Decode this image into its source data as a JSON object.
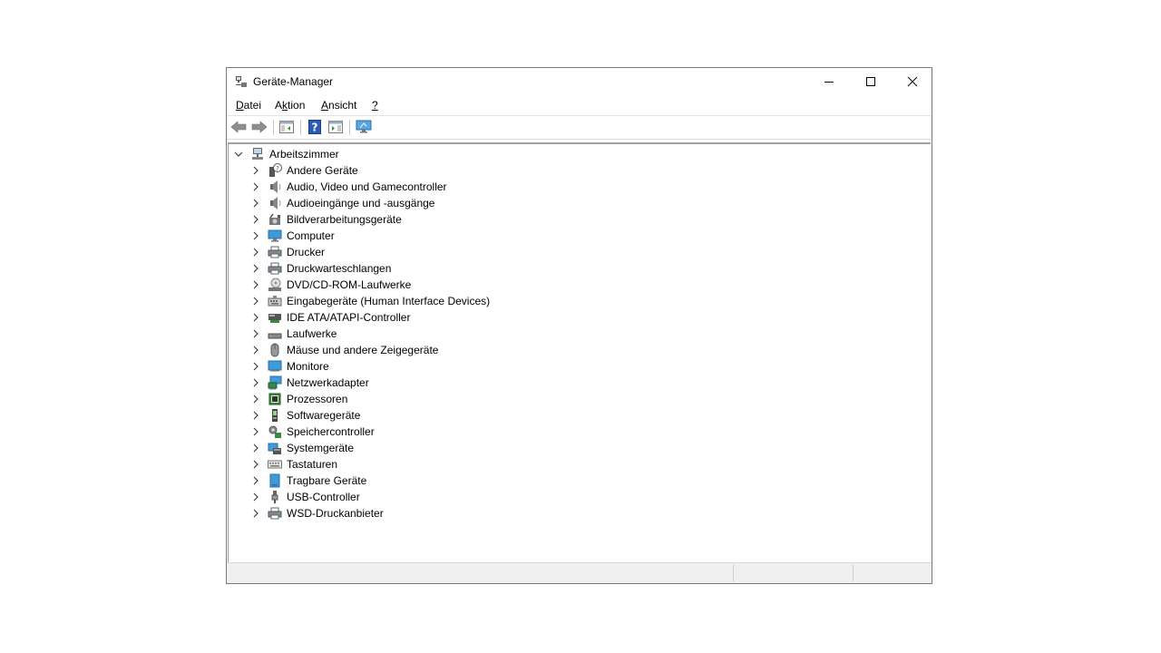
{
  "window": {
    "title": "Geräte-Manager"
  },
  "menu": [
    {
      "label": "Datei",
      "underline_index": 0
    },
    {
      "label": "Aktion",
      "underline_index": 1
    },
    {
      "label": "Ansicht",
      "underline_index": 0
    },
    {
      "label": "?",
      "underline_index": 0
    }
  ],
  "toolbar": [
    {
      "name": "back-button",
      "icon": "arrow-left-icon"
    },
    {
      "name": "forward-button",
      "icon": "arrow-right-icon"
    },
    {
      "name": "show-hide-console-tree-button",
      "icon": "console-tree-icon"
    },
    {
      "name": "help-button",
      "icon": "help-icon"
    },
    {
      "name": "action-pane-button",
      "icon": "action-pane-icon"
    },
    {
      "name": "scan-hardware-button",
      "icon": "monitor-scan-icon"
    }
  ],
  "tree": {
    "root": {
      "label": "Arbeitszimmer",
      "icon": "computer-tree-icon",
      "expanded": true
    },
    "children": [
      {
        "label": "Andere Geräte",
        "icon": "unknown-device-icon"
      },
      {
        "label": "Audio, Video und Gamecontroller",
        "icon": "speaker-icon"
      },
      {
        "label": "Audioeingänge und -ausgänge",
        "icon": "speaker-icon"
      },
      {
        "label": "Bildverarbeitungsgeräte",
        "icon": "camera-icon"
      },
      {
        "label": "Computer",
        "icon": "computer-icon"
      },
      {
        "label": "Drucker",
        "icon": "printer-icon"
      },
      {
        "label": "Druckwarteschlangen",
        "icon": "printer-icon"
      },
      {
        "label": "DVD/CD-ROM-Laufwerke",
        "icon": "dvd-drive-icon"
      },
      {
        "label": "Eingabegeräte (Human Interface Devices)",
        "icon": "hid-icon"
      },
      {
        "label": "IDE ATA/ATAPI-Controller",
        "icon": "ide-controller-icon"
      },
      {
        "label": "Laufwerke",
        "icon": "disk-drive-icon"
      },
      {
        "label": "Mäuse und andere Zeigegeräte",
        "icon": "mouse-icon"
      },
      {
        "label": "Monitore",
        "icon": "monitor-icon"
      },
      {
        "label": "Netzwerkadapter",
        "icon": "network-adapter-icon"
      },
      {
        "label": "Prozessoren",
        "icon": "processor-icon"
      },
      {
        "label": "Softwaregeräte",
        "icon": "software-device-icon"
      },
      {
        "label": "Speichercontroller",
        "icon": "storage-controller-icon"
      },
      {
        "label": "Systemgeräte",
        "icon": "system-device-icon"
      },
      {
        "label": "Tastaturen",
        "icon": "keyboard-icon"
      },
      {
        "label": "Tragbare Geräte",
        "icon": "portable-device-icon"
      },
      {
        "label": "USB-Controller",
        "icon": "usb-icon"
      },
      {
        "label": "WSD-Druckanbieter",
        "icon": "printer-icon"
      }
    ]
  },
  "colors": {
    "accent": "#0078d7",
    "status_bg": "#f0f0f0"
  }
}
